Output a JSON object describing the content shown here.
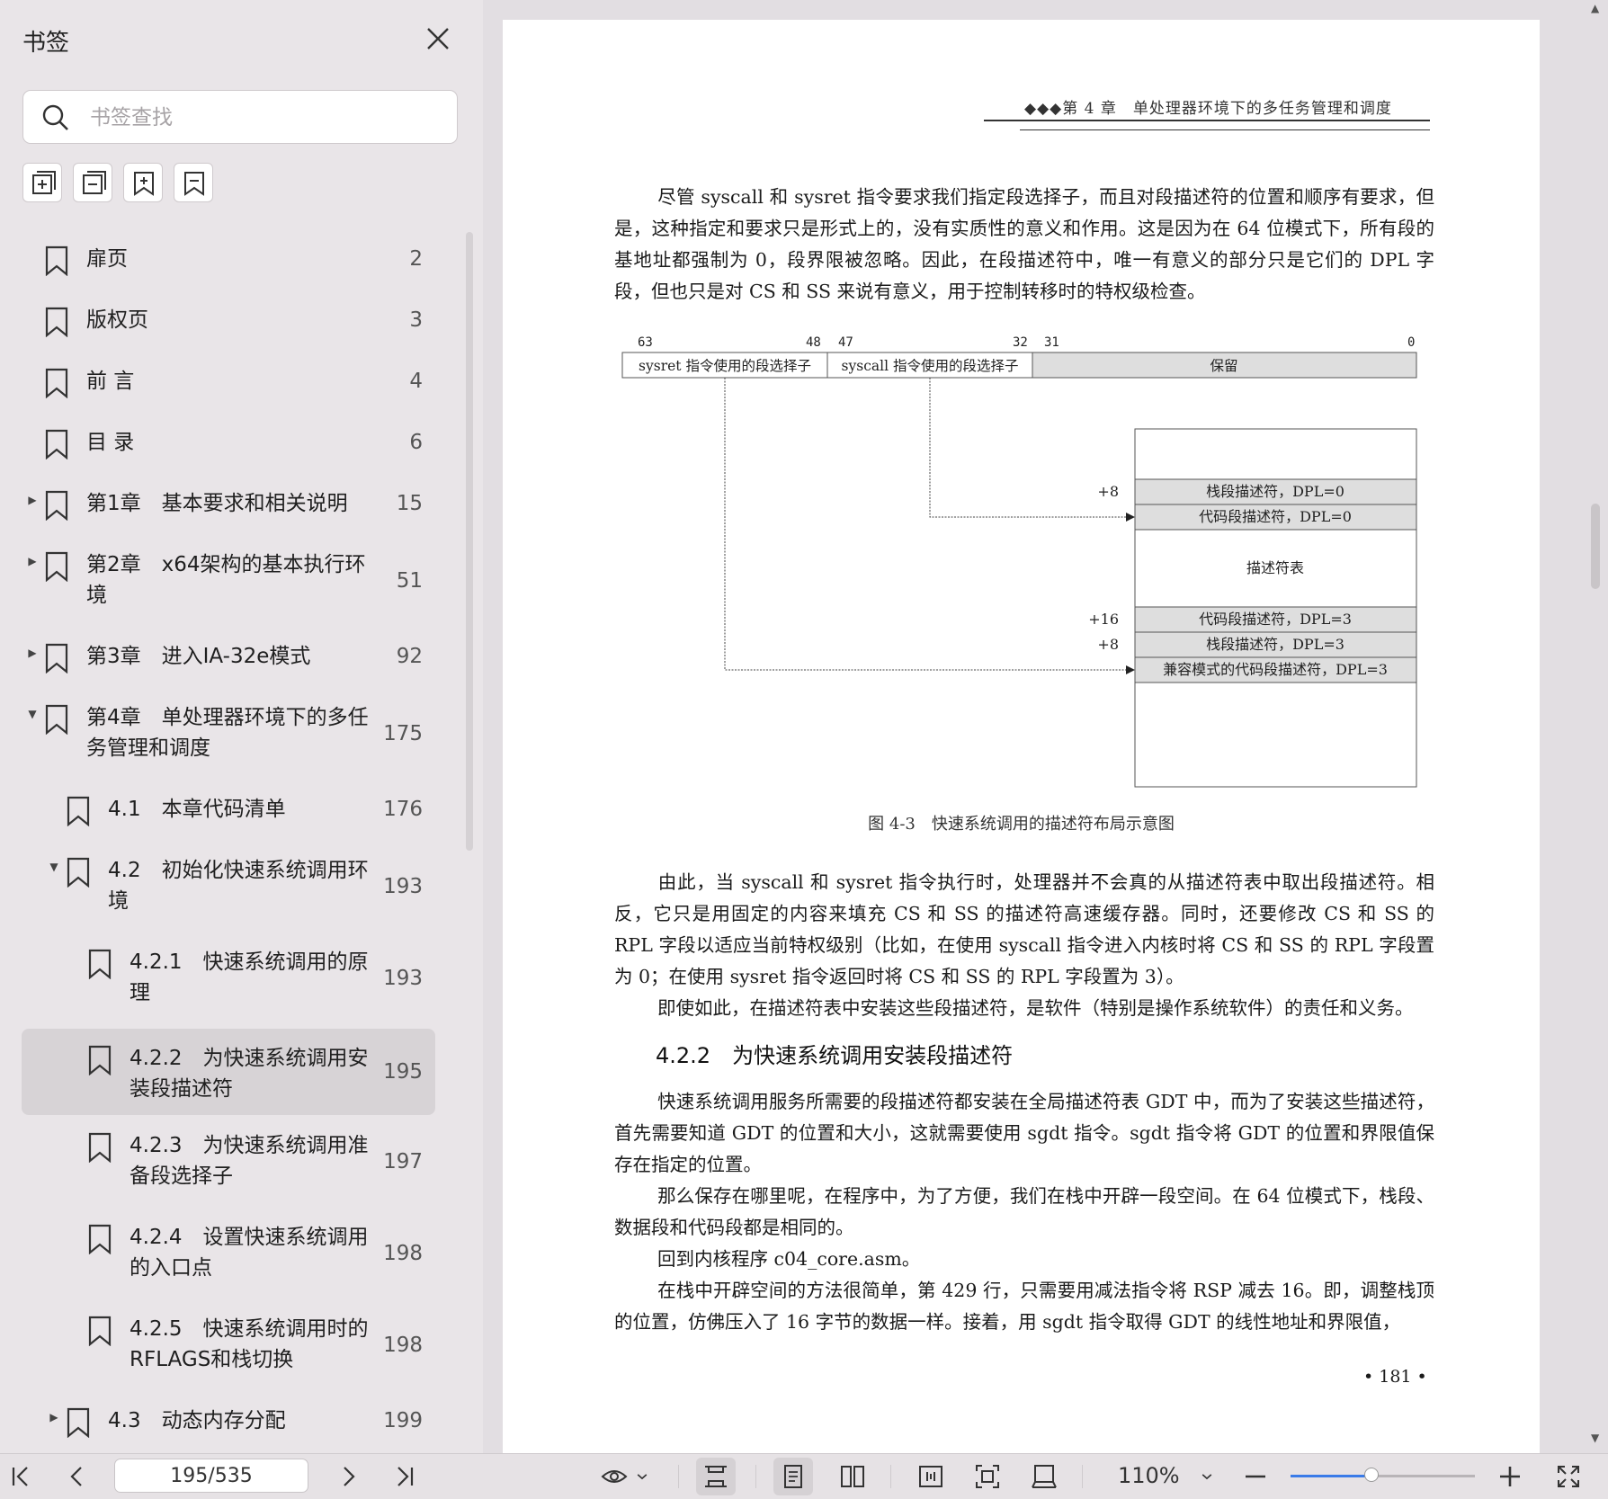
{
  "sidebar": {
    "title": "书签",
    "search_placeholder": "书签查找",
    "tools": [
      "expand-all-icon",
      "collapse-all-icon",
      "add-bookmark-icon",
      "remove-bookmark-icon"
    ],
    "items": [
      {
        "label": "扉页",
        "page": "2"
      },
      {
        "label": "版权页",
        "page": "3"
      },
      {
        "label": "前 言",
        "page": "4"
      },
      {
        "label": "目 录",
        "page": "6"
      },
      {
        "label": "第1章　基本要求和相关说明",
        "page": "15"
      },
      {
        "label": "第2章　x64架构的基本执行环境",
        "page": "51"
      },
      {
        "label": "第3章　进入IA-32e模式",
        "page": "92"
      },
      {
        "label": "第4章　单处理器环境下的多任务管理和调度",
        "page": "175"
      },
      {
        "label": "4.1　本章代码清单",
        "page": "176"
      },
      {
        "label": "4.2　初始化快速系统调用环境",
        "page": "193"
      },
      {
        "label": "4.2.1　快速系统调用的原理",
        "page": "193"
      },
      {
        "label": "4.2.2　为快速系统调用安装段描述符",
        "page": "195"
      },
      {
        "label": "4.2.3　为快速系统调用准备段选择子",
        "page": "197"
      },
      {
        "label": "4.2.4　设置快速系统调用的入口点",
        "page": "198"
      },
      {
        "label": "4.2.5　快速系统调用时的RFLAGS和栈切换",
        "page": "198"
      },
      {
        "label": "4.3　动态内存分配",
        "page": "199"
      }
    ]
  },
  "page": {
    "running_head": "◆◆◆第 4 章　单处理器环境下的多任务管理和调度",
    "para1": "尽管 syscall 和 sysret 指令要求我们指定段选择子，而且对段描述符的位置和顺序有要求，但是，这种指定和要求只是形式上的，没有实质性的意义和作用。这是因为在 64 位模式下，所有段的基地址都强制为 0，段界限被忽略。因此，在段描述符中，唯一有意义的部分只是它们的 DPL 字段，但也只是对 CS 和 SS 来说有意义，用于控制转移时的特权级检查。",
    "figure": {
      "bits": [
        "63",
        "48",
        "47",
        "32",
        "31",
        "0"
      ],
      "fields": [
        "sysret 指令使用的段选择子",
        "syscall 指令使用的段选择子",
        "保留"
      ],
      "offsets": [
        "+8",
        "+16",
        "+8"
      ],
      "rows": [
        "栈段描述符，DPL=0",
        "代码段描述符，DPL=0",
        "描述符表",
        "代码段描述符，DPL=3",
        "栈段描述符，DPL=3",
        "兼容模式的代码段描述符，DPL=3"
      ],
      "caption": "图 4-3　快速系统调用的描述符布局示意图"
    },
    "para2": "由此，当 syscall 和 sysret 指令执行时，处理器并不会真的从描述符表中取出段描述符。相反，它只是用固定的内容来填充 CS 和 SS 的描述符高速缓存器。同时，还要修改 CS 和 SS 的 RPL 字段以适应当前特权级别（比如，在使用 syscall 指令进入内核时将 CS 和 SS 的 RPL 字段置为 0；在使用 sysret 指令返回时将 CS 和 SS 的 RPL 字段置为 3）。",
    "para3": "即使如此，在描述符表中安装这些段描述符，是软件（特别是操作系统软件）的责任和义务。",
    "section_heading": "4.2.2　为快速系统调用安装段描述符",
    "para4": "快速系统调用服务所需要的段描述符都安装在全局描述符表 GDT 中，而为了安装这些描述符，首先需要知道 GDT 的位置和大小，这就需要使用 sgdt 指令。sgdt 指令将 GDT 的位置和界限值保存在指定的位置。",
    "para5": "那么保存在哪里呢，在程序中，为了方便，我们在栈中开辟一段空间。在 64 位模式下，栈段、数据段和代码段都是相同的。",
    "para6": "回到内核程序 c04_core.asm。",
    "para7": "在栈中开辟空间的方法很简单，第 429 行，只需要用减法指令将 RSP 减去 16。即，调整栈顶的位置，仿佛压入了 16 字节的数据一样。接着，用 sgdt 指令取得 GDT 的线性地址和界限值，",
    "page_number": "• 181 •"
  },
  "toolbar": {
    "page_indicator": "195/535",
    "zoom": "110%",
    "zoom_fraction": 0.44,
    "accent": "#3a7be8"
  }
}
